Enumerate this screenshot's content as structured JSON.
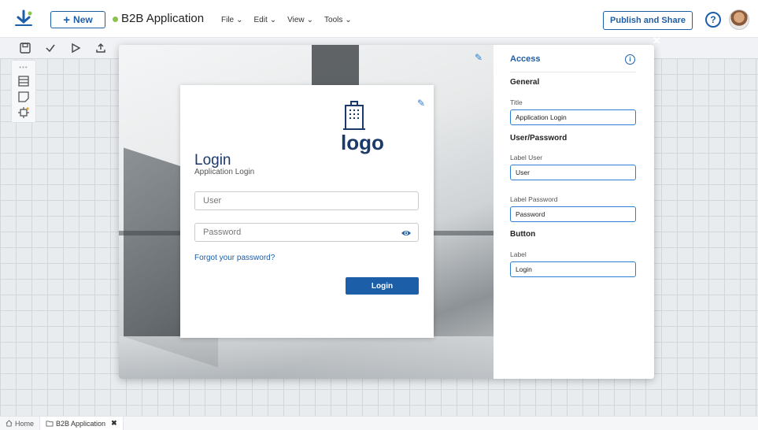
{
  "topbar": {
    "new_label": "New",
    "app_title": "B2B Application",
    "menu": [
      "File",
      "Edit",
      "View",
      "Tools"
    ],
    "publish_label": "Publish and Share",
    "help_symbol": "?"
  },
  "modal": {
    "card": {
      "logo_text": "logo",
      "title": "Login",
      "subtitle": "Application Login",
      "user_placeholder": "User",
      "password_placeholder": "Password",
      "forgot_link": "Forgot your password?",
      "login_button": "Login"
    },
    "panel": {
      "heading": "Access",
      "info_symbol": "i",
      "sections": {
        "general": "General",
        "user_password": "User/Password",
        "button": "Button"
      },
      "fields": {
        "title_label": "Title",
        "title_value": "Application Login",
        "label_user_label": "Label User",
        "label_user_value": "User",
        "label_password_label": "Label Password",
        "label_password_value": "Password",
        "button_label_label": "Label",
        "button_label_value": "Login"
      }
    }
  },
  "bottom_tabs": [
    {
      "label": "Home",
      "icon": "home-icon"
    },
    {
      "label": "B2B Application",
      "icon": "folder-icon",
      "closable": true
    }
  ],
  "colors": {
    "accent": "#1d5ea8",
    "status_dot": "#8bc34a",
    "logo": "#1b3a6b"
  }
}
